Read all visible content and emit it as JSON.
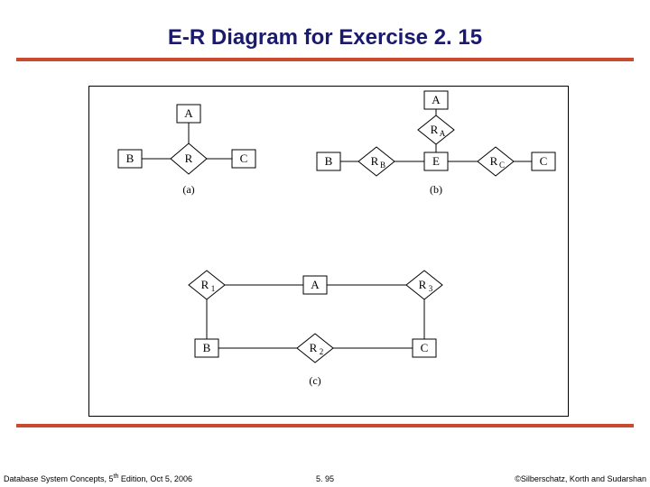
{
  "title": "E-R Diagram for Exercise 2. 15",
  "footer": {
    "left_prefix": "Database System Concepts, 5",
    "left_sup": "th",
    "left_suffix": " Edition, Oct 5, 2006",
    "center": "5. 95",
    "right": "©Silberschatz, Korth and Sudarshan"
  },
  "diagram": {
    "parts": {
      "a": {
        "caption": "(a)",
        "entities": {
          "A": "A",
          "B": "B",
          "C": "C"
        },
        "relationship": "R"
      },
      "b": {
        "caption": "(b)",
        "entities": {
          "A": "A",
          "B": "B",
          "C": "C",
          "E": "E"
        },
        "relationships": {
          "RA": {
            "main": "R",
            "sub": "A"
          },
          "RB": {
            "main": "R",
            "sub": "B"
          },
          "RC": {
            "main": "R",
            "sub": "C"
          }
        }
      },
      "c": {
        "caption": "(c)",
        "entities": {
          "A": "A",
          "B": "B",
          "C": "C"
        },
        "relationships": {
          "R1": {
            "main": "R",
            "sub": "1"
          },
          "R2": {
            "main": "R",
            "sub": "2"
          },
          "R3": {
            "main": "R",
            "sub": "3"
          }
        }
      }
    }
  }
}
